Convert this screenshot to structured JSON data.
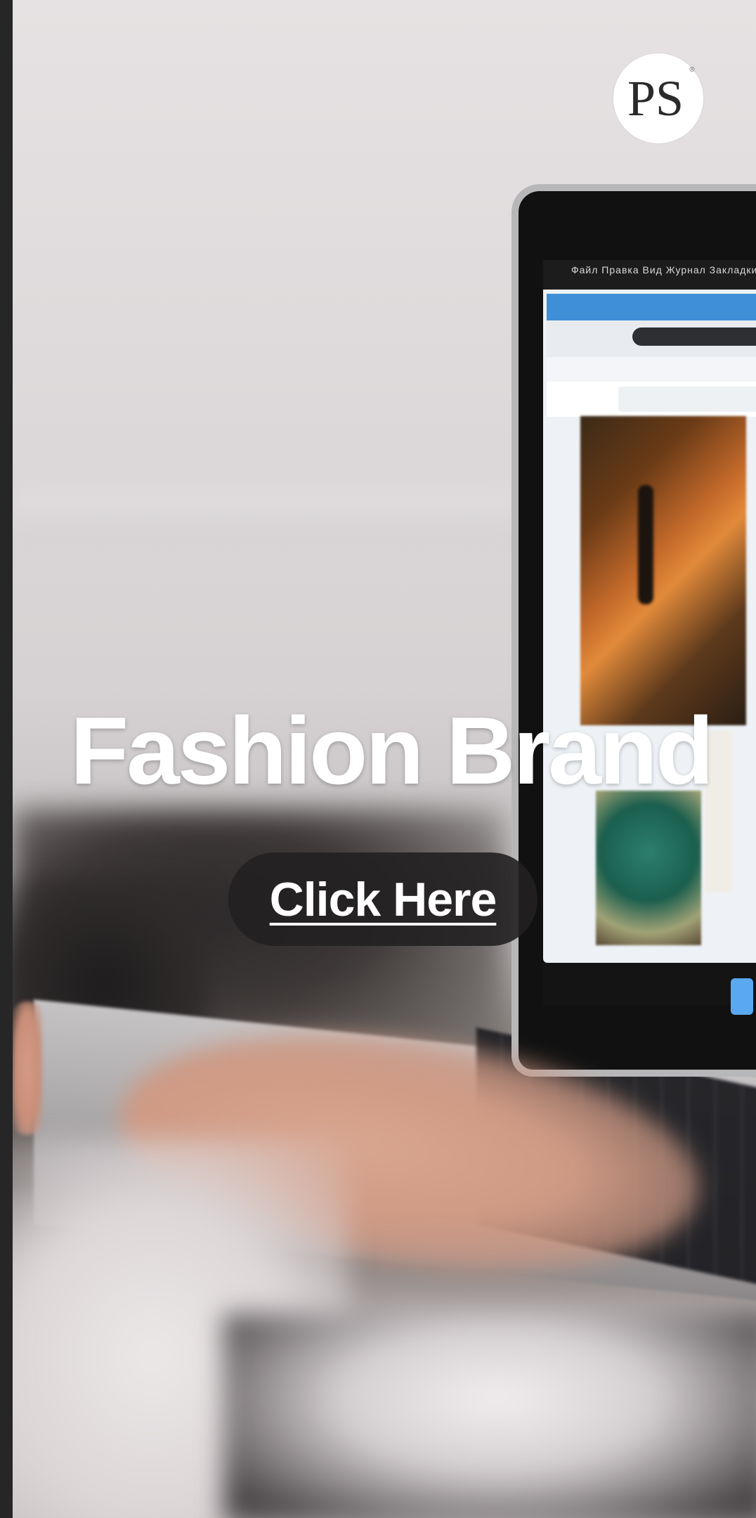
{
  "brand": {
    "logo_text": "PS",
    "logo_mark": "®"
  },
  "hero": {
    "headline": "Fashion Brand",
    "cta_label": "Click Here",
    "background_description_icon": "laptop-photo"
  },
  "screen": {
    "menu_text": "Файл  Правка  Вид  Журнал  Закладки  Инструменты"
  },
  "colors": {
    "headline": "#ffffff",
    "cta_background": "#222021",
    "cta_text": "#ffffff",
    "left_bar": "#262626"
  }
}
